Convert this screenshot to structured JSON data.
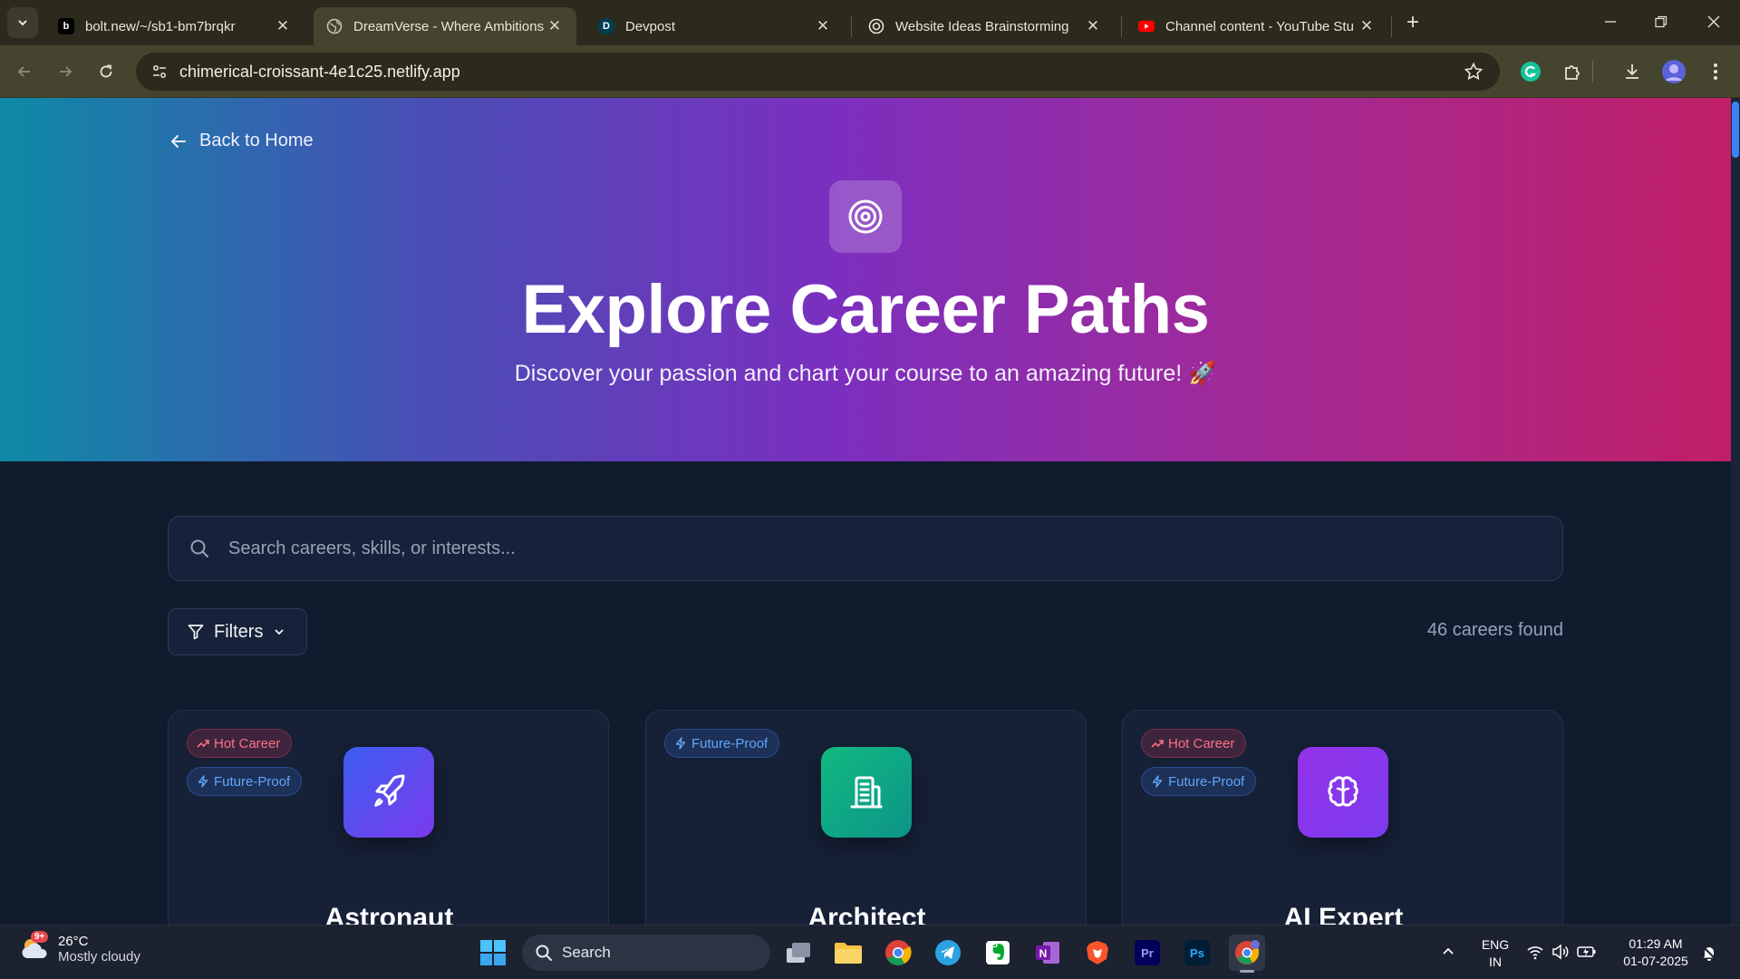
{
  "browser": {
    "tabs": [
      {
        "title": "bolt.new/~/sb1-bm7brqkr",
        "favicon": "bolt-icon",
        "active": false
      },
      {
        "title": "DreamVerse - Where Ambitions",
        "favicon": "globe-icon",
        "active": true
      },
      {
        "title": "Devpost",
        "favicon": "devpost-icon",
        "active": false
      },
      {
        "title": "Website Ideas Brainstorming",
        "favicon": "openai-icon",
        "active": false
      },
      {
        "title": "Channel content - YouTube Stu",
        "favicon": "youtube-icon",
        "active": false
      }
    ],
    "url": "chimerical-croissant-4e1c25.netlify.app"
  },
  "page": {
    "back_label": "Back to Home",
    "title": "Explore Career Paths",
    "subtitle": "Discover your passion and chart your course to an amazing future! 🚀",
    "search_placeholder": "Search careers, skills, or interests...",
    "filters_label": "Filters",
    "results_count": "46 careers found",
    "careers": [
      {
        "name": "Astronaut",
        "icon": "rocket-icon",
        "badges": [
          "Hot Career",
          "Future-Proof"
        ],
        "icon_gradient": [
          "#3b5ef0",
          "#7c3aed"
        ]
      },
      {
        "name": "Architect",
        "icon": "building-icon",
        "badges": [
          "Future-Proof"
        ],
        "icon_gradient": [
          "#10b981",
          "#0d9488"
        ]
      },
      {
        "name": "AI Expert",
        "icon": "brain-icon",
        "badges": [
          "Hot Career",
          "Future-Proof"
        ],
        "icon_gradient": [
          "#9333ea",
          "#7c3aed"
        ]
      }
    ]
  },
  "taskbar": {
    "weather_badge": "9+",
    "temperature": "26°C",
    "condition": "Mostly cloudy",
    "search_label": "Search",
    "language": "ENG",
    "region": "IN",
    "time": "01:29 AM",
    "date": "01-07-2025"
  },
  "colors": {
    "hero_gradient": [
      "#0e8aa6",
      "#4a4db5",
      "#7b2fbf",
      "#a12a98",
      "#c01f66"
    ],
    "page_background": "#111b2e",
    "hot_badge": "#fb7185",
    "future_badge": "#60a5fa"
  }
}
